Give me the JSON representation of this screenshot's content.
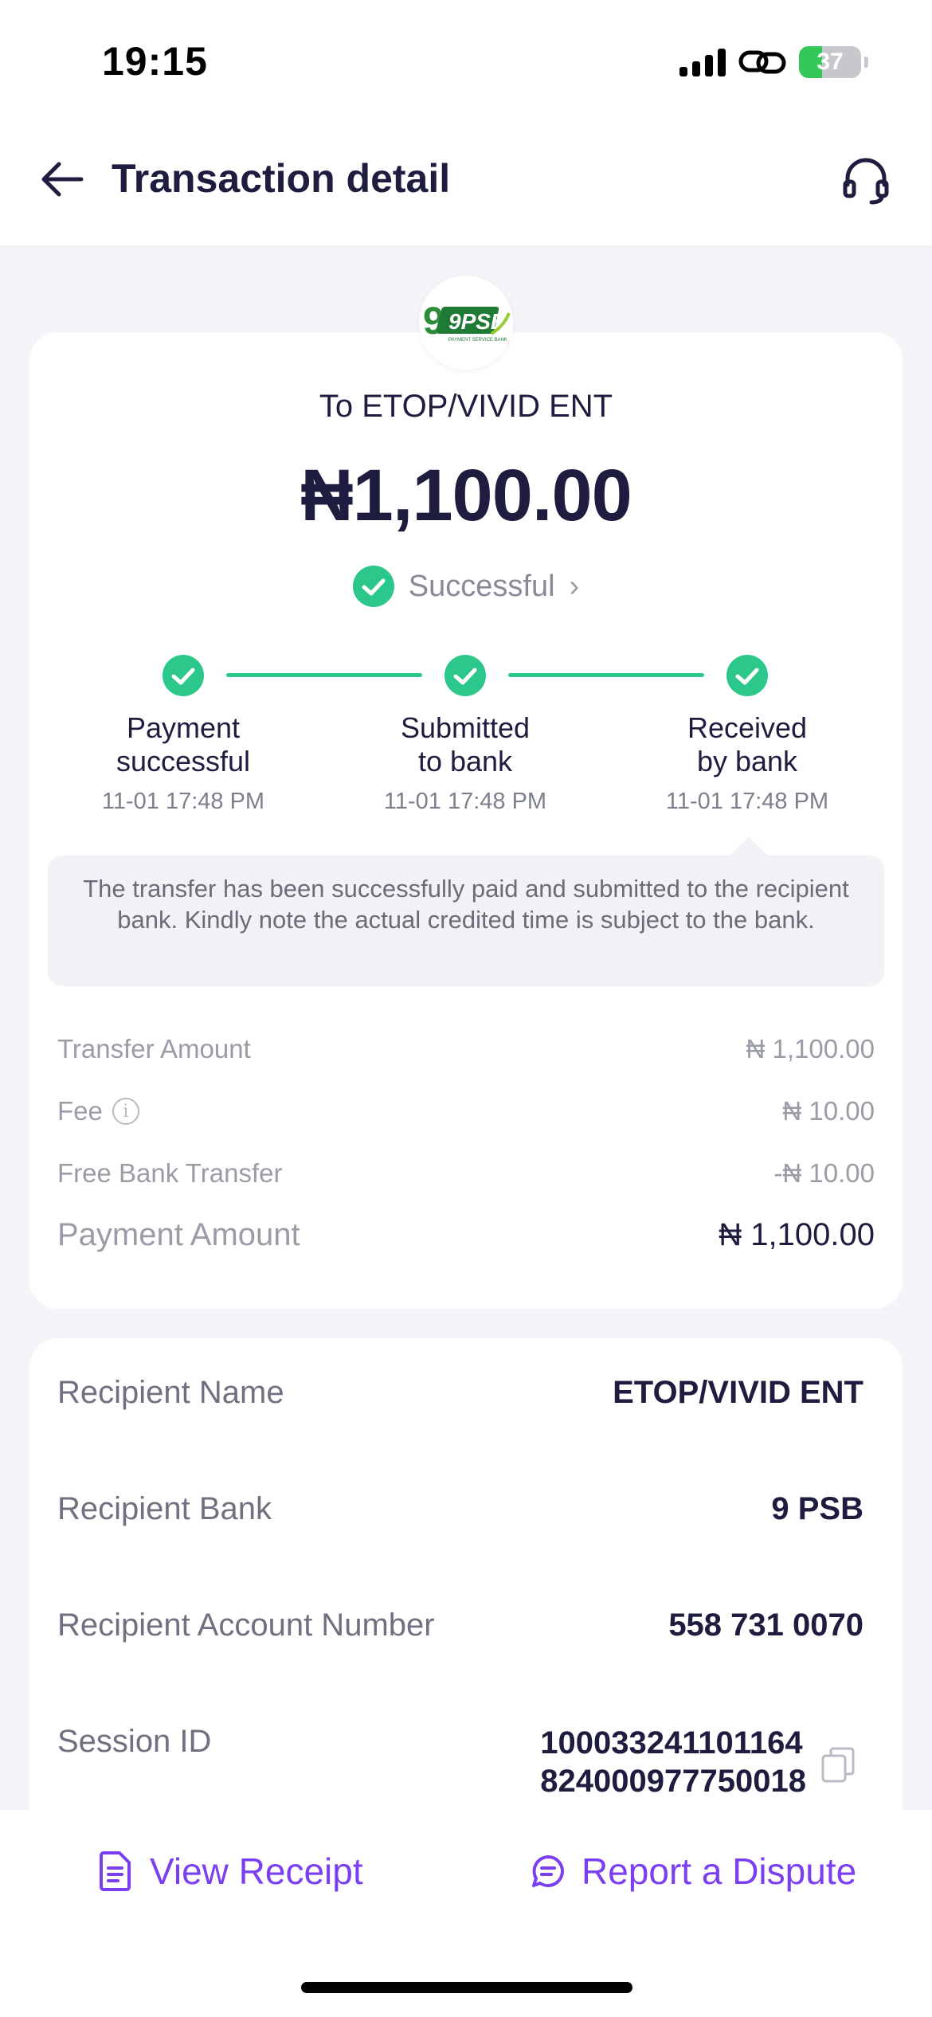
{
  "status_bar": {
    "time": "19:15",
    "battery": "37",
    "battery_level": 0.37
  },
  "header": {
    "title": "Transaction detail"
  },
  "summary": {
    "bank_logo_text": "9PSB",
    "bank_logo_subtext": "PAYMENT SERVICE BANK",
    "recipient_line": "To ETOP/VIVID ENT",
    "amount": "₦1,100.00",
    "status": "Successful"
  },
  "steps": [
    {
      "label_line1": "Payment",
      "label_line2": "successful",
      "time": "11-01 17:48 PM"
    },
    {
      "label_line1": "Submitted",
      "label_line2": "to bank",
      "time": "11-01 17:48 PM"
    },
    {
      "label_line1": "Received",
      "label_line2": "by bank",
      "time": "11-01 17:48 PM"
    }
  ],
  "note": "The transfer has been successfully paid and submitted to the recipient bank. Kindly note the actual credited time is subject to the bank.",
  "fees": [
    {
      "label": "Transfer Amount",
      "value": "₦ 1,100.00"
    },
    {
      "label": "Fee",
      "value": "₦ 10.00"
    },
    {
      "label": "Free Bank Transfer",
      "value": "-₦ 10.00"
    },
    {
      "label": "Payment Amount",
      "value": "₦ 1,100.00"
    }
  ],
  "details": [
    {
      "label": "Recipient Name",
      "value": "ETOP/VIVID ENT"
    },
    {
      "label": "Recipient Bank",
      "value": "9 PSB"
    },
    {
      "label": "Recipient Account Number",
      "value": "558 731 0070"
    },
    {
      "label": "Session ID",
      "value_line1": "100033241101164",
      "value_line2": "824000977750018"
    }
  ],
  "actions": {
    "view_receipt": "View Receipt",
    "report_dispute": "Report a Dispute"
  },
  "colors": {
    "accent_purple": "#7b3ff2",
    "success_green": "#2cc78a",
    "text_dark": "#1f1d3f"
  }
}
